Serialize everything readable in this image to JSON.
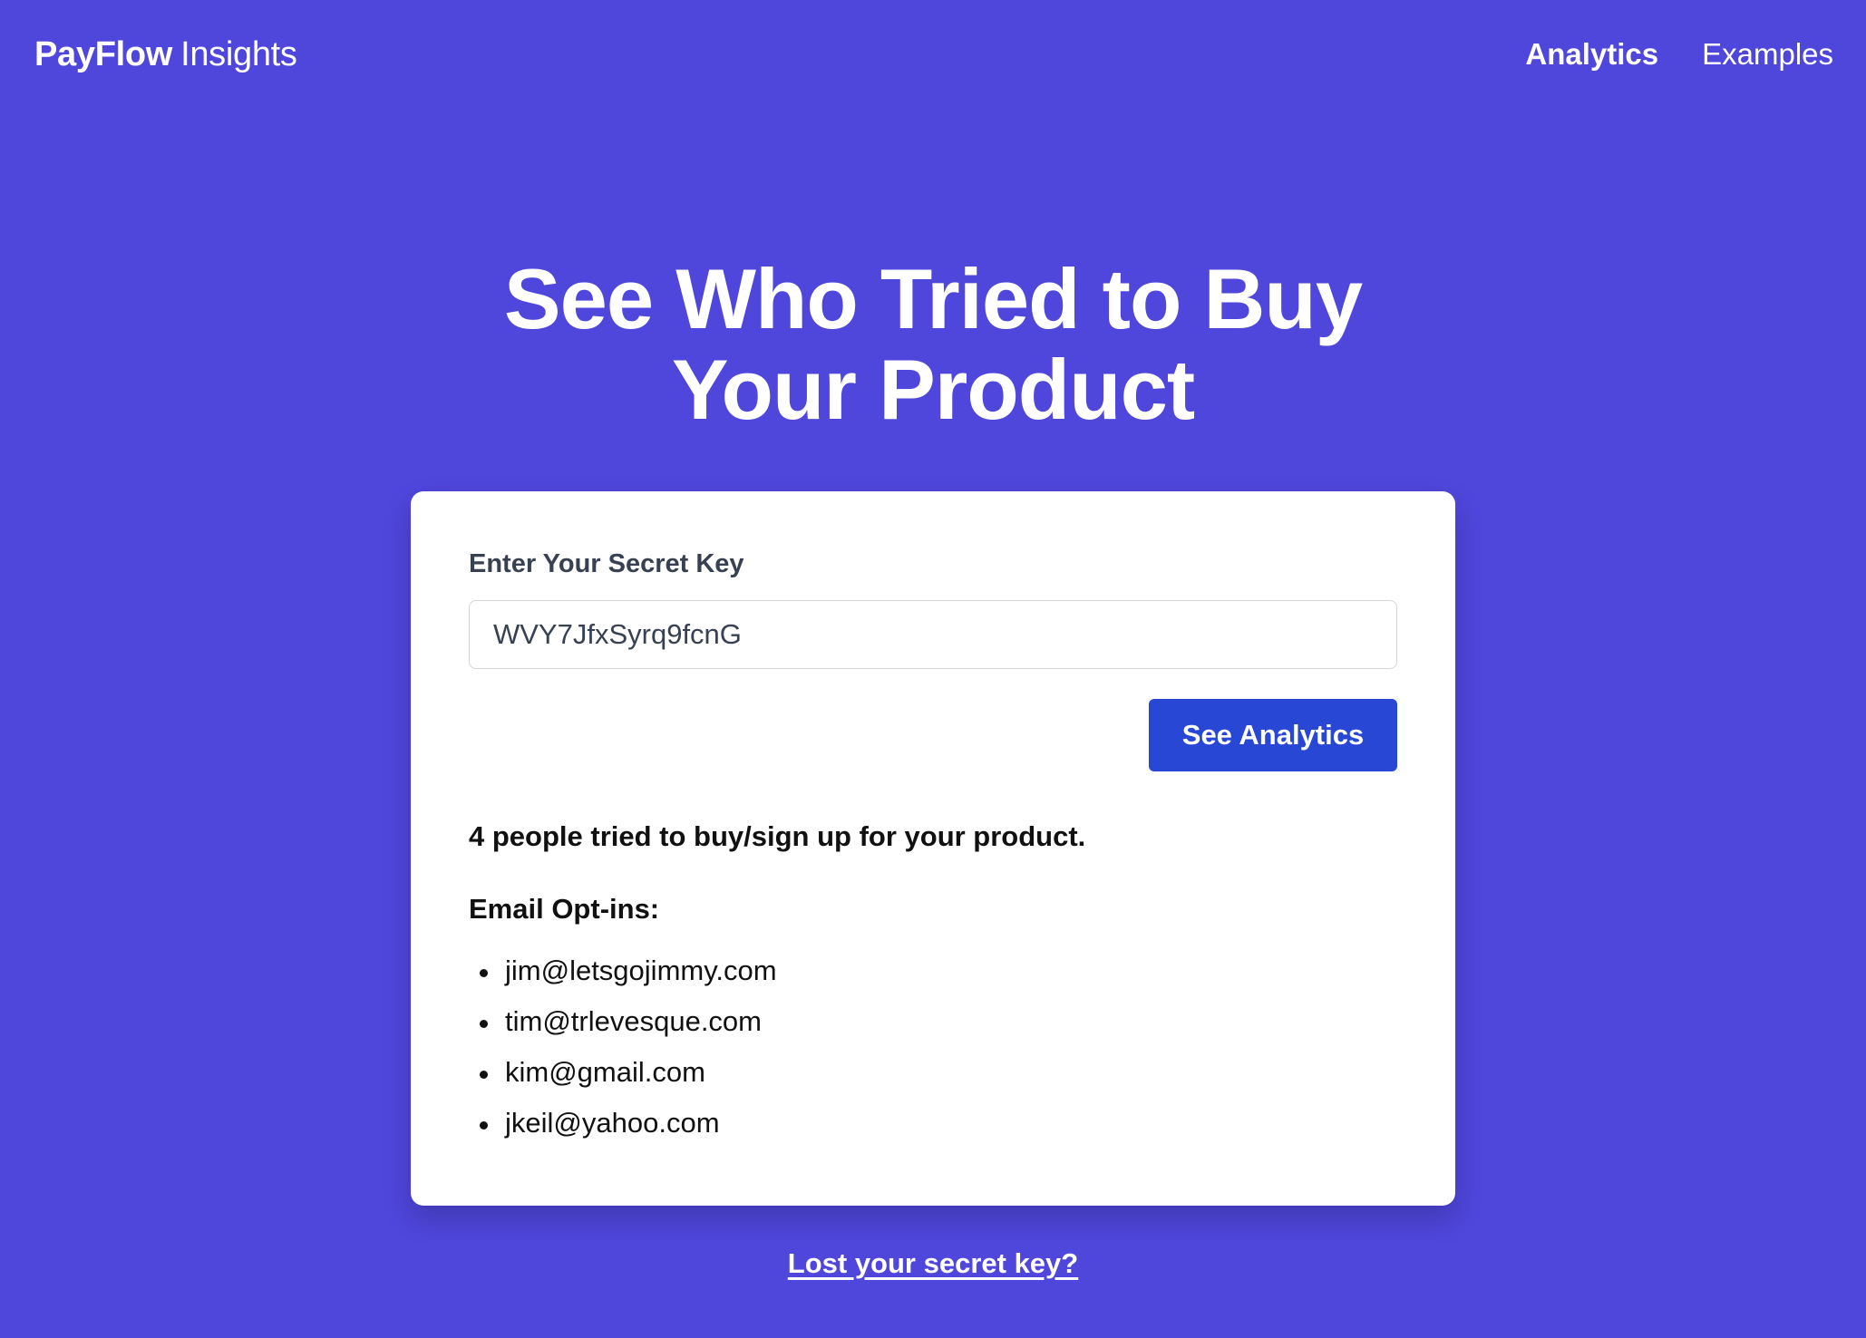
{
  "header": {
    "brand_bold": "PayFlow",
    "brand_light": "Insights",
    "nav": [
      {
        "label": "Analytics",
        "active": true
      },
      {
        "label": "Examples",
        "active": false
      }
    ]
  },
  "hero": {
    "line1": "See Who Tried to Buy",
    "line2": "Your Product"
  },
  "form": {
    "label": "Enter Your Secret Key",
    "key_value": "WVY7JfxSyrq9fcnG",
    "button_label": "See Analytics"
  },
  "results": {
    "summary": "4 people tried to buy/sign up for your product.",
    "optins_heading": "Email Opt-ins:",
    "emails": [
      "jim@letsgojimmy.com",
      "tim@trlevesque.com",
      "kim@gmail.com",
      "jkeil@yahoo.com"
    ]
  },
  "footer": {
    "lost_key_link": "Lost your secret key?"
  },
  "colors": {
    "background": "#4f46dc",
    "button": "#2747d4",
    "card": "#ffffff"
  }
}
